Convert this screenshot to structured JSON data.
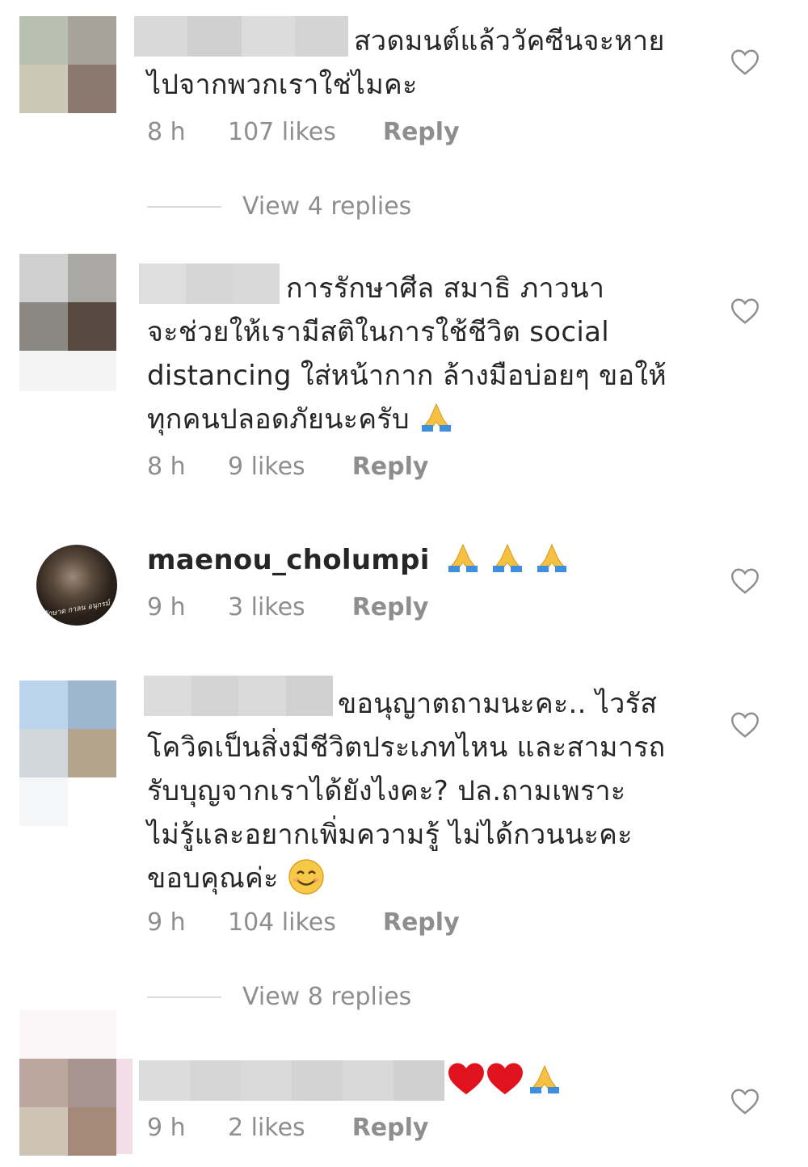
{
  "comments": [
    {
      "username": "",
      "text": "สวดมนต์แล้ววัคซีนจะหายไปจากพวกเราใช่ไมคะ",
      "text_line1": "สวดมนต์แล้ววัคซีนจะหาย",
      "text_line2": "ไปจากพวกเราใช่ไมคะ",
      "age": "8 h",
      "likes": "107 likes",
      "reply_label": "Reply",
      "view_replies": "View 4 replies"
    },
    {
      "username": "",
      "text_line1": "การรักษาศีล สมาธิ ภาวนา",
      "text_line2": "จะช่วยให้เรามีสติในการใช้ชีวิต social",
      "text_line3": "distancing ใส่หน้ากาก ล้างมือบ่อยๆ ขอให้",
      "text_line4": "ทุกคนปลอดภัยนะครับ",
      "emoji": "folded-hands",
      "age": "8 h",
      "likes": "9 likes",
      "reply_label": "Reply"
    },
    {
      "username": "maenou_cholumpi",
      "avatar_caption": "รักษาด กาลน อนุกรม์",
      "emoji": "folded-hands x3",
      "age": "9 h",
      "likes": "3 likes",
      "reply_label": "Reply"
    },
    {
      "username": "",
      "text_line1": "ขอนุญาตถามนะคะ.. ไวรัส",
      "text_line2": "โควิดเป็นสิ่งมีชีวิตประเภทไหน และสามารถ",
      "text_line3": "รับบุญจากเราได้ยังไงคะ? ปล.ถามเพราะ",
      "text_line4": "ไม่รู้และอยากเพิ่มความรู้ ไม่ได้กวนนะคะ",
      "text_line5": "ขอบคุณค่ะ",
      "emoji": "smiling-face",
      "age": "9 h",
      "likes": "104 likes",
      "reply_label": "Reply",
      "view_replies": "View 8 replies"
    },
    {
      "username": "",
      "emoji": "red-heart x2, folded-hands",
      "age": "9 h",
      "likes": "2 likes",
      "reply_label": "Reply"
    }
  ],
  "colors": {
    "text": "#262626",
    "muted": "#8e8e8e",
    "divider": "#dbdbdb",
    "heart_emoji": "#e0121d",
    "pray_emoji": "#f6c142"
  },
  "icons": {
    "like": "heart-outline-icon"
  }
}
